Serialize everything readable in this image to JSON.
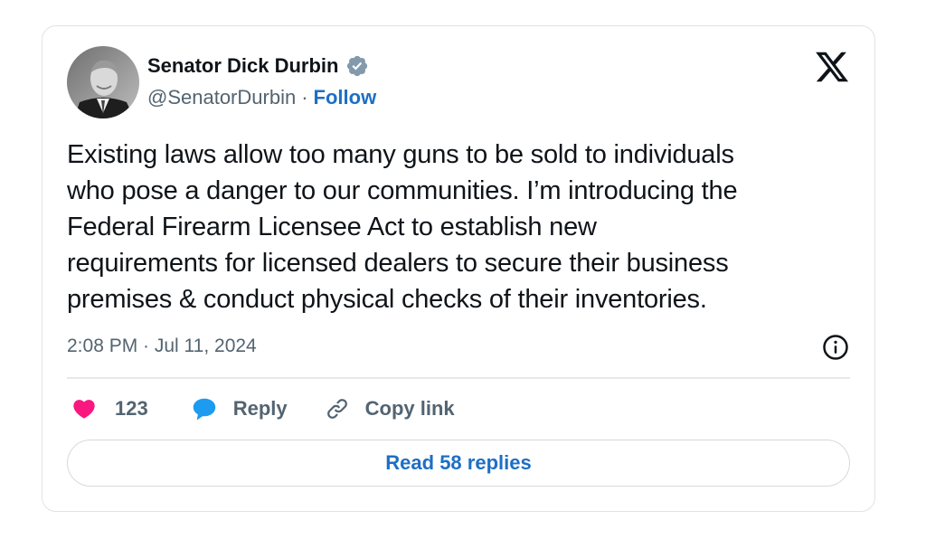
{
  "author": {
    "name": "Senator Dick Durbin",
    "handle": "@SenatorDurbin",
    "separator": "·",
    "follow_label": "Follow",
    "verified_icon": "verified-badge-icon"
  },
  "platform_icon": "x-logo-icon",
  "tweet": {
    "text": "Existing laws allow too many guns to be sold to individuals\nwho pose a danger to our communities. I’m introducing the\nFederal Firearm Licensee Act to establish new\nrequirements for licensed dealers to secure their business\npremises & conduct physical checks of their inventories.",
    "timestamp": "2:08 PM · Jul 11, 2024"
  },
  "actions": {
    "like_count": "123",
    "reply_label": "Reply",
    "copy_link_label": "Copy link"
  },
  "read_replies_label": "Read 58 replies",
  "colors": {
    "like": "#f91880",
    "reply": "#1d9bf0",
    "link": "#1d6fc4",
    "verified": "#829aab",
    "muted": "#536471"
  }
}
